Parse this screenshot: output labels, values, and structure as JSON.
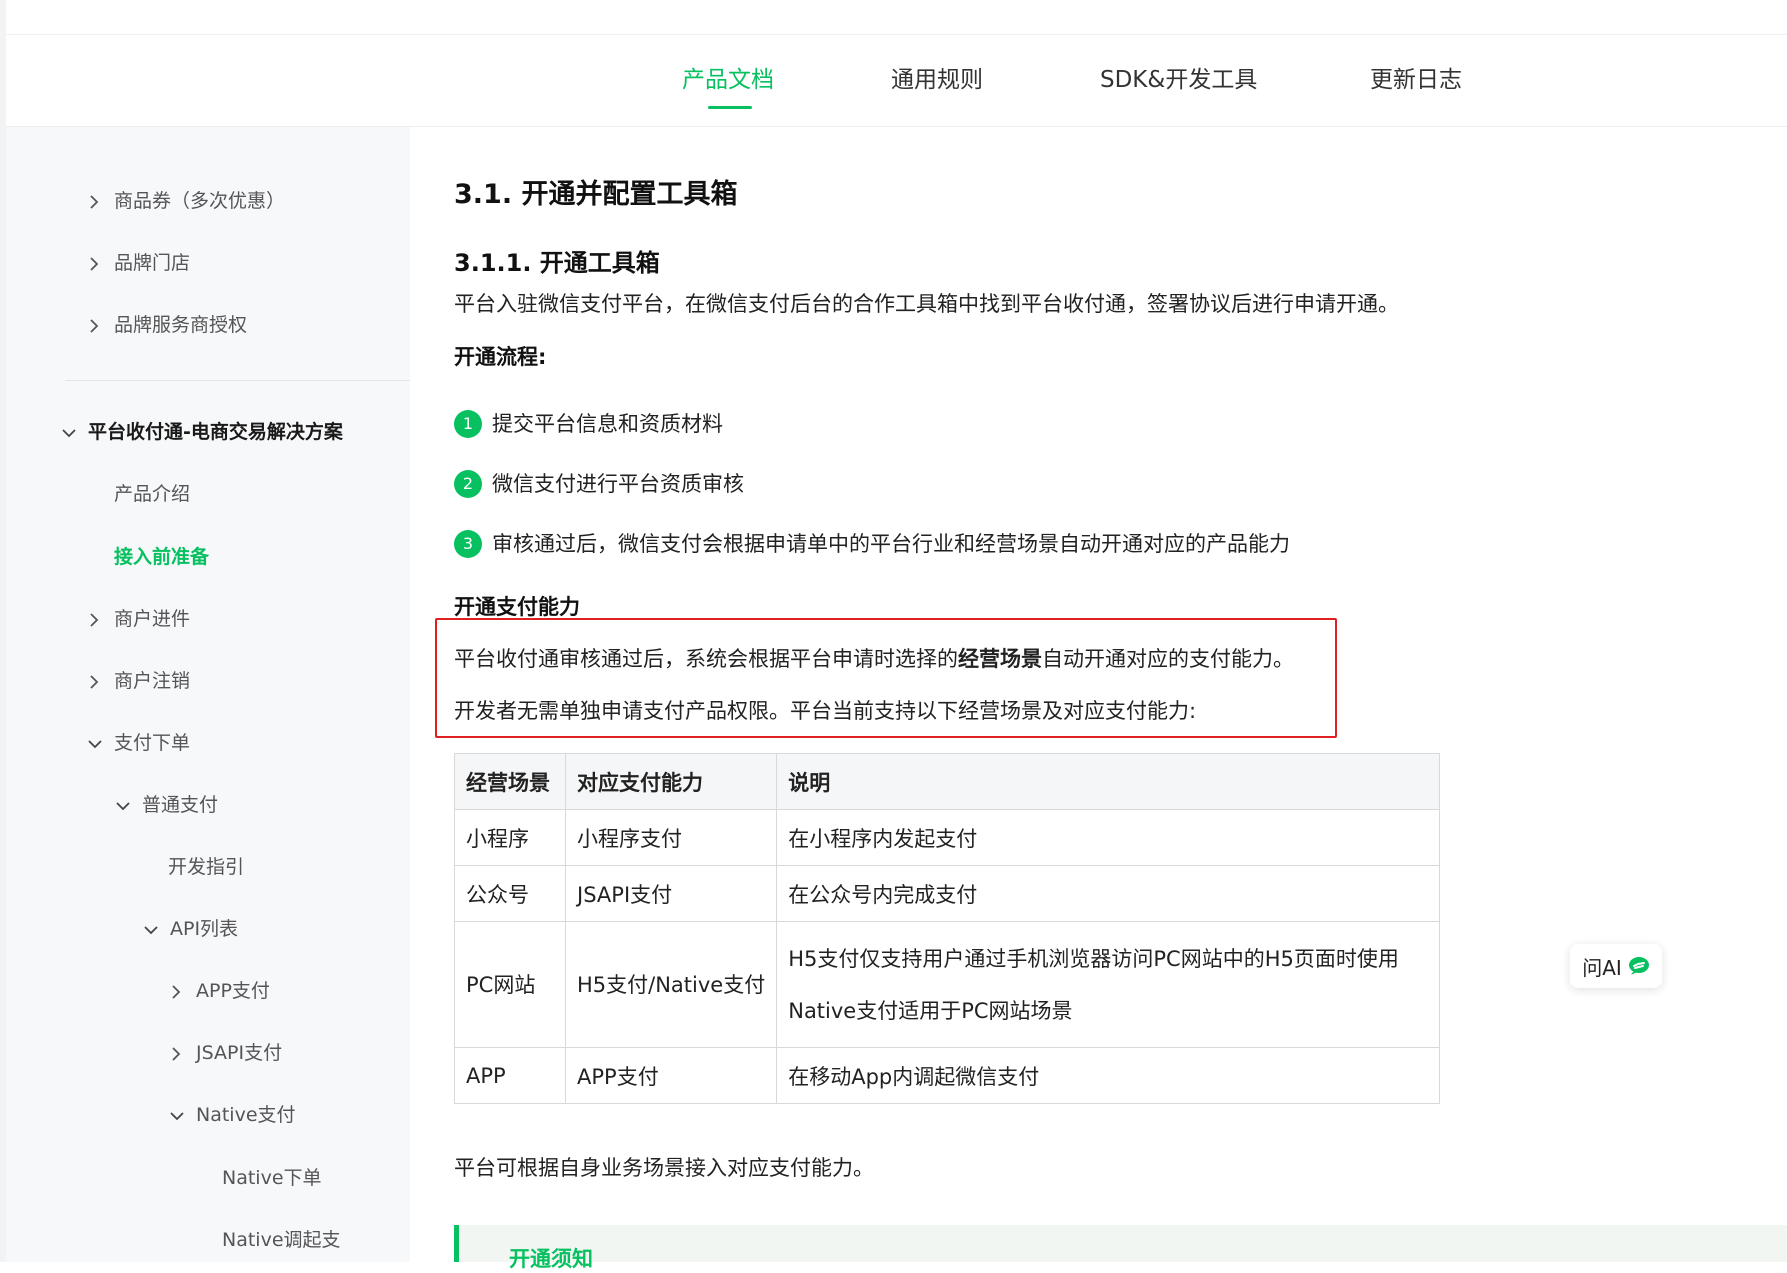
{
  "header": {
    "tabs": [
      {
        "label": "产品文档",
        "active": true
      },
      {
        "label": "通用规则",
        "active": false
      },
      {
        "label": "SDK&开发工具",
        "active": false
      },
      {
        "label": "更新日志",
        "active": false
      }
    ]
  },
  "sidebar": {
    "items": [
      {
        "label": "商品券（多次优惠）",
        "caret": "right"
      },
      {
        "label": "品牌门店",
        "caret": "right"
      },
      {
        "label": "品牌服务商授权",
        "caret": "right"
      },
      {
        "label": "平台收付通-电商交易解决方案",
        "caret": "down"
      },
      {
        "label": "产品介绍"
      },
      {
        "label": "接入前准备",
        "active": true
      },
      {
        "label": "商户进件",
        "caret": "right"
      },
      {
        "label": "商户注销",
        "caret": "right"
      },
      {
        "label": "支付下单",
        "caret": "down"
      },
      {
        "label": "普通支付",
        "caret": "down"
      },
      {
        "label": "开发指引"
      },
      {
        "label": "API列表",
        "caret": "down"
      },
      {
        "label": "APP支付",
        "caret": "right"
      },
      {
        "label": "JSAPI支付",
        "caret": "right"
      },
      {
        "label": "Native支付",
        "caret": "down"
      },
      {
        "label": "Native下单"
      },
      {
        "label": "Native调起支"
      }
    ]
  },
  "content": {
    "h2": "3.1. 开通并配置工具箱",
    "h3": "3.1.1. 开通工具箱",
    "intro": "平台入驻微信支付平台，在微信支付后台的合作工具箱中找到平台收付通，签署协议后进行申请开通。",
    "flow_title": "开通流程:",
    "steps": [
      {
        "num": "1",
        "text": "提交平台信息和资质材料"
      },
      {
        "num": "2",
        "text": "微信支付进行平台资质审核"
      },
      {
        "num": "3",
        "text": "审核通过后，微信支付会根据申请单中的平台行业和经营场景自动开通对应的产品能力"
      }
    ],
    "ability_title": "开通支付能力",
    "box_line1_pre": "平台收付通审核通过后，系统会根据平台申请时选择的",
    "box_line1_bold": "经营场景",
    "box_line1_post": "自动开通对应的支付能力。",
    "box_line2": "开发者无需单独申请支付产品权限。平台当前支持以下经营场景及对应支付能力:",
    "table": {
      "headers": [
        "经营场景",
        "对应支付能力",
        "说明"
      ],
      "rows": [
        [
          "小程序",
          "小程序支付",
          "在小程序内发起支付"
        ],
        [
          "公众号",
          "JSAPI支付",
          "在公众号内完成支付"
        ],
        [
          "PC网站",
          "H5支付/Native支付",
          "H5支付仅支持用户通过手机浏览器访问PC网站中的H5页面时使用",
          "Native支付适用于PC网站场景"
        ],
        [
          "APP",
          "APP支付",
          "在移动App内调起微信支付"
        ]
      ]
    },
    "outro": "平台可根据自身业务场景接入对应支付能力。",
    "notice_title": "开通须知"
  },
  "ask_ai": {
    "label": "问AI"
  },
  "colors": {
    "accent": "#07c160",
    "highlight_box": "#e02020"
  }
}
